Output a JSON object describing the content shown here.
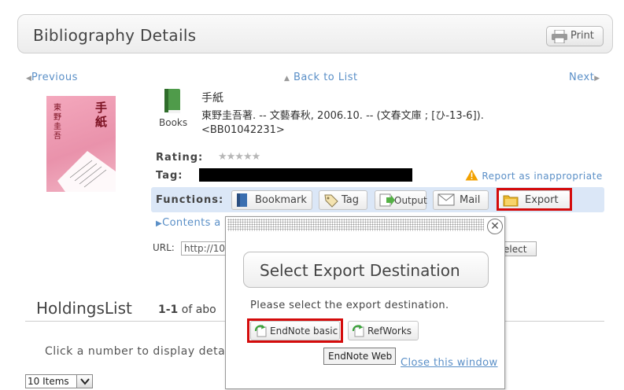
{
  "header": {
    "title": "Bibliography Details",
    "print_label": "Print"
  },
  "nav": {
    "previous": "Previous",
    "back_to_list": "Back to List",
    "next": "Next"
  },
  "record": {
    "cover_title": "手紙",
    "cover_author": "東野圭吾",
    "type": "Books",
    "title": "手紙",
    "description_line1": "東野圭吾著. -- 文藝春秋, 2006.10. -- (文春文庫 ; [ひ-13-6]).",
    "description_line2": "<BB01042231>",
    "rating_label": "Rating:",
    "rating_stars": "★★★★★",
    "rating_value": 0,
    "tag_label": "Tag:",
    "report_label": "Report as inappropriate"
  },
  "functions": {
    "label": "Functions:",
    "bookmark": "Bookmark",
    "tag": "Tag",
    "output": "Output",
    "mail": "Mail",
    "export": "Export"
  },
  "contents_label": "Contents a",
  "url": {
    "label": "URL:",
    "value": "http://10",
    "select_label": "elect"
  },
  "holdings": {
    "title": "HoldingsList",
    "range": "1-1",
    "of_text": " of abo",
    "hint": "Click a number to display deta",
    "items_select": "10 Items"
  },
  "popup": {
    "close_glyph": "✕",
    "heading": "Select Export Destination",
    "instruction": "Please select the export destination.",
    "endnote_basic": "EndNote basic",
    "refworks": "RefWorks",
    "close_window": "Close this window",
    "tooltip": "EndNote Web"
  },
  "colors": {
    "link": "#5a8fc7",
    "functions_bar": "#dbe7f7",
    "highlight": "#d40b0b"
  }
}
